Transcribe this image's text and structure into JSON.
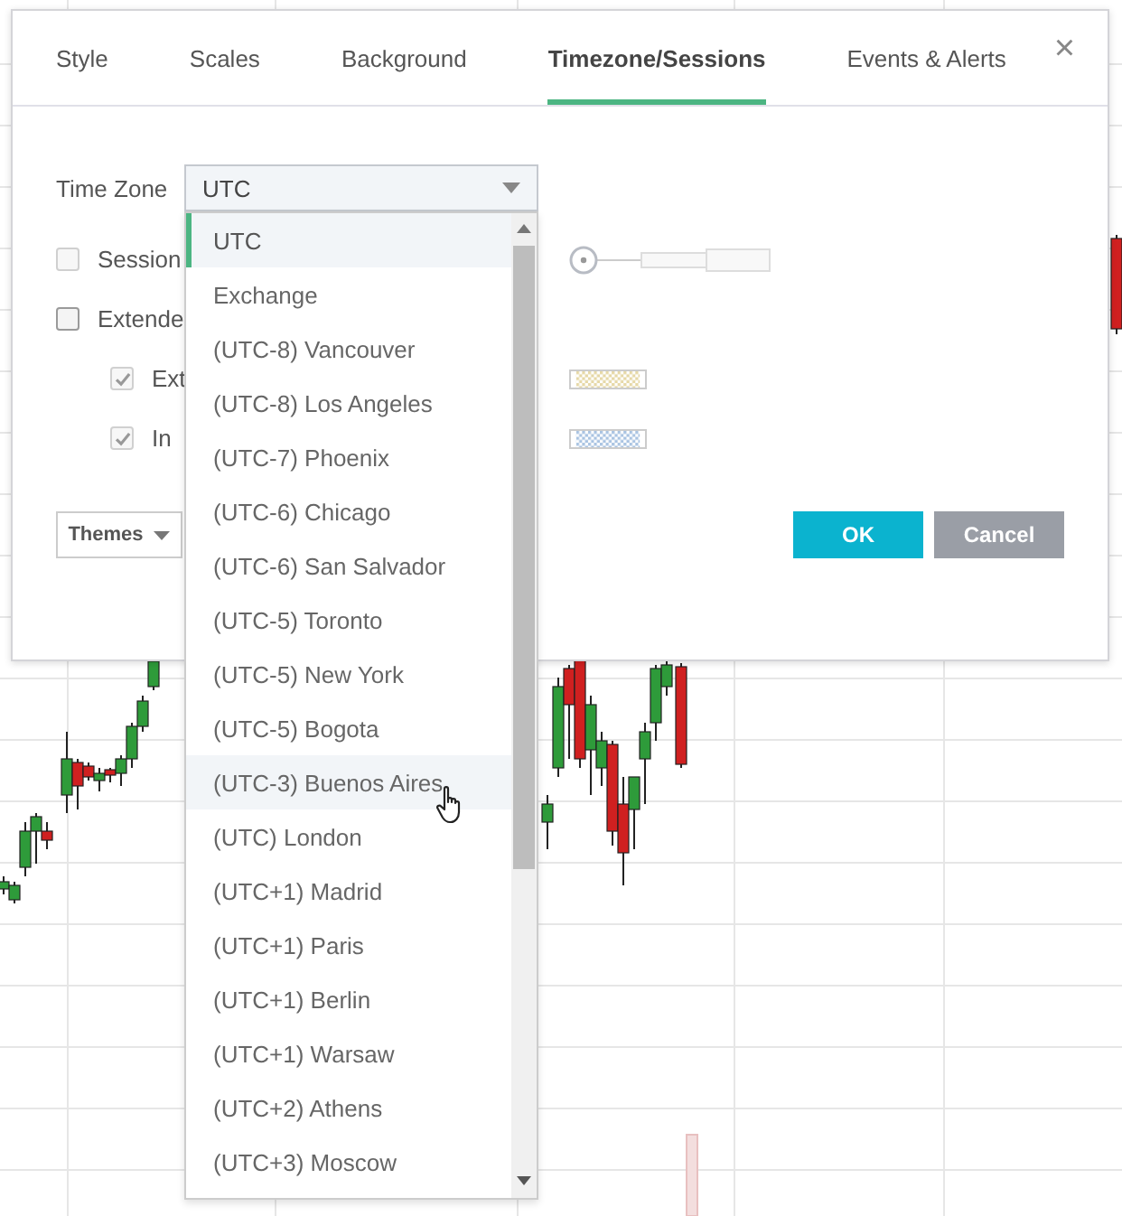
{
  "tabs": [
    {
      "label": "Style",
      "selected": false
    },
    {
      "label": "Scales",
      "selected": false
    },
    {
      "label": "Background",
      "selected": false
    },
    {
      "label": "Timezone/Sessions",
      "selected": true
    },
    {
      "label": "Events & Alerts",
      "selected": false
    }
  ],
  "close": "×",
  "time_zone": {
    "label": "Time Zone",
    "value": "UTC",
    "expanded": true,
    "options": [
      {
        "label": "UTC",
        "selected": true,
        "hovered": false
      },
      {
        "label": "Exchange",
        "selected": false,
        "hovered": false
      },
      {
        "label": "(UTC-8) Vancouver",
        "selected": false,
        "hovered": false
      },
      {
        "label": "(UTC-8) Los Angeles",
        "selected": false,
        "hovered": false
      },
      {
        "label": "(UTC-7) Phoenix",
        "selected": false,
        "hovered": false
      },
      {
        "label": "(UTC-6) Chicago",
        "selected": false,
        "hovered": false
      },
      {
        "label": "(UTC-6) San Salvador",
        "selected": false,
        "hovered": false
      },
      {
        "label": "(UTC-5) Toronto",
        "selected": false,
        "hovered": false
      },
      {
        "label": "(UTC-5) New York",
        "selected": false,
        "hovered": false
      },
      {
        "label": "(UTC-5) Bogota",
        "selected": false,
        "hovered": false
      },
      {
        "label": "(UTC-3) Buenos Aires",
        "selected": false,
        "hovered": true
      },
      {
        "label": "(UTC) London",
        "selected": false,
        "hovered": false
      },
      {
        "label": "(UTC+1) Madrid",
        "selected": false,
        "hovered": false
      },
      {
        "label": "(UTC+1) Paris",
        "selected": false,
        "hovered": false
      },
      {
        "label": "(UTC+1) Berlin",
        "selected": false,
        "hovered": false
      },
      {
        "label": "(UTC+1) Warsaw",
        "selected": false,
        "hovered": false
      },
      {
        "label": "(UTC+2) Athens",
        "selected": false,
        "hovered": false
      },
      {
        "label": "(UTC+3) Moscow",
        "selected": false,
        "hovered": false
      }
    ]
  },
  "rows": [
    {
      "label": "Session",
      "kind": "slider",
      "checked": false,
      "disabled": true,
      "level": 0
    },
    {
      "label": "Extende",
      "kind": "plain",
      "checked": false,
      "disabled": false,
      "children": [
        {
          "label": "Ext",
          "kind": "swatch",
          "checked": true,
          "disabled": true,
          "color": "#e6d8a6"
        },
        {
          "label": "In",
          "kind": "swatch",
          "checked": true,
          "disabled": true,
          "color": "#a9c3e2"
        }
      ]
    }
  ],
  "themes_button": "Themes",
  "buttons": [
    {
      "label": "OK",
      "kind": "primary"
    },
    {
      "label": "Cancel",
      "kind": "secondary"
    }
  ]
}
